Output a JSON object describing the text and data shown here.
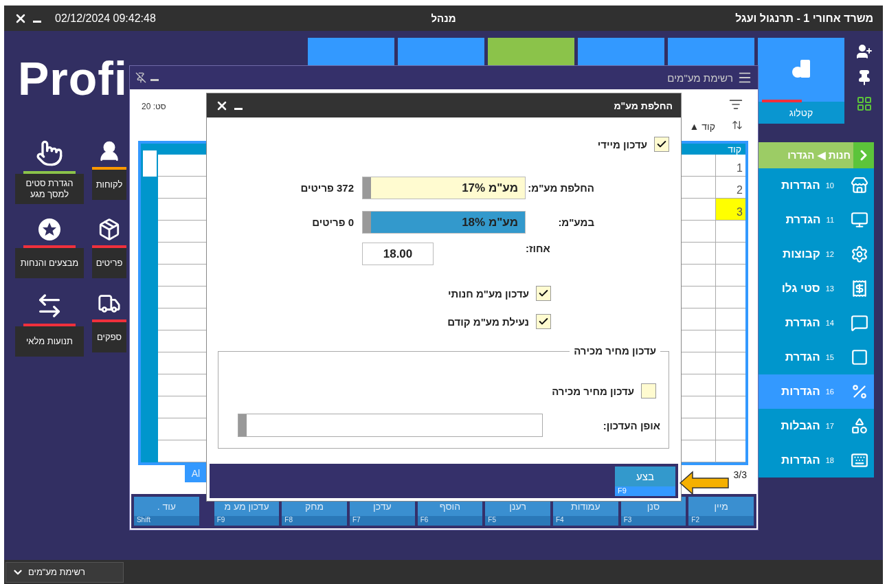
{
  "top_bar": {
    "datetime": "02/12/2024 09:42:48",
    "title": "מנהל",
    "location": "משרד אחורי  1 - תרנגול ועגל"
  },
  "logo": "Profi",
  "top_tiles": [
    {
      "color": "#3399ff"
    },
    {
      "color": "#3399ff"
    },
    {
      "color": "#8bc34a"
    },
    {
      "color": "#3399ff"
    },
    {
      "color": "#3399ff"
    }
  ],
  "catalog_tile": {
    "label": "קטלוג"
  },
  "left_tiles": [
    {
      "label": "לקוחות",
      "color": "#ff9800"
    },
    {
      "label": "הגדרת סטים למסך מגע",
      "color": "#8bc34a"
    },
    {
      "label": "פריטים",
      "color": "#f0303c"
    },
    {
      "label": "מבצעים והנחות",
      "color": "#f0303c"
    },
    {
      "label": "ספקים",
      "color": "#f0303c"
    },
    {
      "label": "תנועות מלאי",
      "color": "#f0303c"
    }
  ],
  "side_menu": {
    "header": "חנות ◀ הגדרו",
    "items": [
      {
        "number": "10",
        "label": "הגדרות",
        "selected": false
      },
      {
        "number": "11",
        "label": "הגדרת",
        "selected": false
      },
      {
        "number": "12",
        "label": "קבוצות",
        "selected": false
      },
      {
        "number": "13",
        "label": "סטי גלו",
        "selected": false
      },
      {
        "number": "14",
        "label": "הגדרת",
        "selected": false
      },
      {
        "number": "15",
        "label": "הגדרת",
        "selected": false
      },
      {
        "number": "16",
        "label": "הגדרות",
        "selected": true
      },
      {
        "number": "17",
        "label": "הגבלות",
        "selected": false
      },
      {
        "number": "18",
        "label": "הגדרות",
        "selected": false
      }
    ]
  },
  "vat_list_window": {
    "title": "רשימת מע\"מים",
    "set_label": "סט: 20",
    "sort_label": "קוד ▲",
    "table": {
      "columns": [
        "קוד"
      ],
      "rows": [
        {
          "code": "1",
          "selected": false
        },
        {
          "code": "2",
          "selected": false
        },
        {
          "code": "3",
          "selected": true
        }
      ]
    },
    "side_tab": "Al",
    "page": "3/3",
    "function_keys": [
      {
        "label": "מיין",
        "key": "F2"
      },
      {
        "label": "סנן",
        "key": "F3"
      },
      {
        "label": "עמודות",
        "key": "F4"
      },
      {
        "label": "רענן",
        "key": "F5"
      },
      {
        "label": "הוסף",
        "key": "F6"
      },
      {
        "label": "עדכן",
        "key": "F7"
      },
      {
        "label": "מחק",
        "key": "F8"
      },
      {
        "label": "עדכון מע מ",
        "key": "F9"
      },
      {
        "label": "עוד .",
        "key": "Shift"
      }
    ]
  },
  "dialog": {
    "title": "החלפת מע\"מ",
    "immediate_update": {
      "label": "עדכון מיידי",
      "checked": true
    },
    "selects": [
      {
        "label": "החלפת מע\"מ:",
        "value": "מע\"מ 17%",
        "count": "372 פריטים",
        "selected": false
      },
      {
        "label": "במע\"מ:",
        "value": "מע\"מ 18%",
        "count": "0 פריטים",
        "selected": true
      }
    ],
    "percent": {
      "label": "אחוז:",
      "value": "18.00"
    },
    "options": [
      {
        "label": "עדכון מע\"מ חנותי",
        "checked": true
      },
      {
        "label": "נעילת מע\"מ קודם",
        "checked": true
      }
    ],
    "price_group": {
      "title": "עדכון מחיר מכירה",
      "update_price": {
        "label": "עדכון מחיר מכירה",
        "checked": false
      },
      "method_label": "אופן העדכון:"
    },
    "execute_button": {
      "label": "בצע",
      "key": "F9"
    }
  },
  "taskbar": {
    "item": "רשימת מע\"מים"
  }
}
